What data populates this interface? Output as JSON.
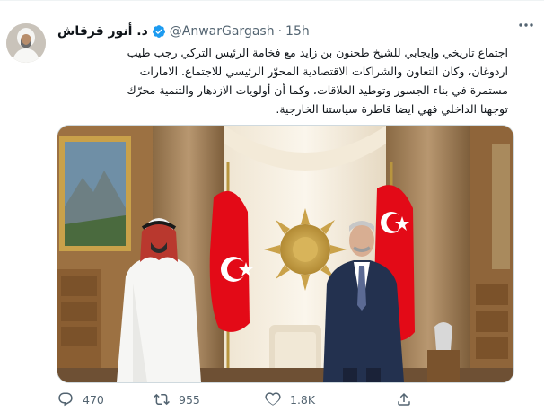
{
  "tweet": {
    "display_name": "د. أنور قرقاش",
    "handle": "@AnwarGargash",
    "separator": "·",
    "time": "15h",
    "text_lines": [
      "اجتماع تاريخي وإيجابي للشيخ طحنون بن زايد مع فخامة الرئيس التركي رجب طيب",
      "اردوغان، وكان التعاون والشراكات الاقتصادية المحوّر الرئيسي للاجتماع. الامارات",
      "مستمرة في بناء الجسور وتوطيد العلاقات، وكما أن أولويات الازدهار والتنمية محرّك",
      "توجهنا الداخلي فهي ايضا قاطرة سياستنا الخارجية."
    ]
  },
  "actions": {
    "reply_count": "470",
    "retweet_count": "955",
    "like_count": "1.8K"
  },
  "icons": {
    "more": "more-options-icon",
    "verified": "verified-badge-icon",
    "reply": "reply-icon",
    "retweet": "retweet-icon",
    "like": "like-icon",
    "share": "share-icon"
  },
  "colors": {
    "verified": "#1d9bf0",
    "secondary_text": "#536471",
    "flag_red": "#e30a17",
    "suit_navy": "#23314f"
  }
}
